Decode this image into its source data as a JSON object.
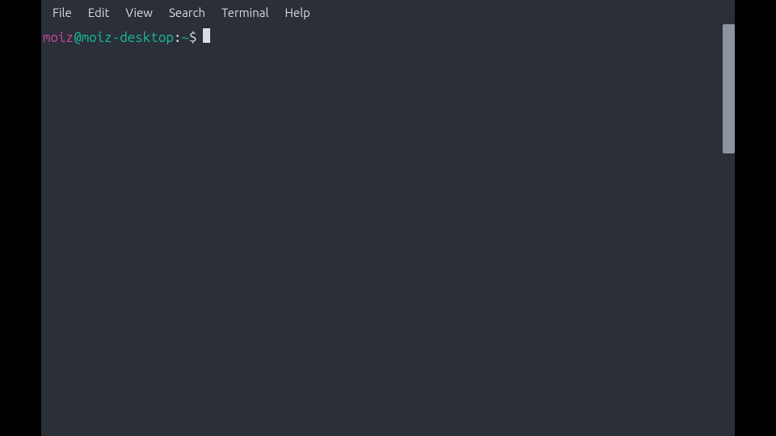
{
  "menubar": {
    "items": [
      "File",
      "Edit",
      "View",
      "Search",
      "Terminal",
      "Help"
    ]
  },
  "prompt": {
    "user": "moiz",
    "at": "@",
    "host": "moiz-desktop",
    "colon": ":",
    "path": "~",
    "dollar": "$"
  }
}
